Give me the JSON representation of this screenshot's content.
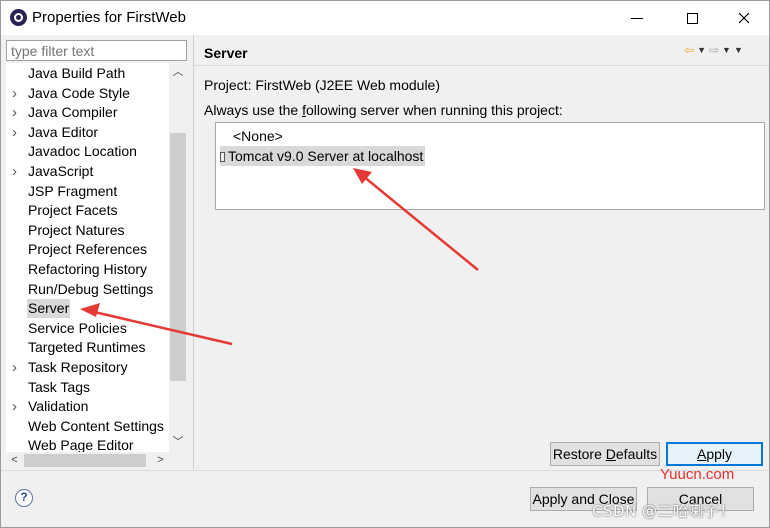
{
  "window": {
    "title": "Properties for FirstWeb",
    "controls": {
      "minimize": "minimize",
      "maximize": "maximize",
      "close": "close"
    }
  },
  "filter": {
    "placeholder": "type filter text"
  },
  "tree": {
    "items": [
      {
        "label": "Java Build Path",
        "expandable": false
      },
      {
        "label": "Java Code Style",
        "expandable": true
      },
      {
        "label": "Java Compiler",
        "expandable": true
      },
      {
        "label": "Java Editor",
        "expandable": true
      },
      {
        "label": "Javadoc Location",
        "expandable": false
      },
      {
        "label": "JavaScript",
        "expandable": true
      },
      {
        "label": "JSP Fragment",
        "expandable": false
      },
      {
        "label": "Project Facets",
        "expandable": false
      },
      {
        "label": "Project Natures",
        "expandable": false
      },
      {
        "label": "Project References",
        "expandable": false
      },
      {
        "label": "Refactoring History",
        "expandable": false
      },
      {
        "label": "Run/Debug Settings",
        "expandable": false
      },
      {
        "label": "Server",
        "expandable": false,
        "selected": true
      },
      {
        "label": "Service Policies",
        "expandable": false
      },
      {
        "label": "Targeted Runtimes",
        "expandable": false
      },
      {
        "label": "Task Repository",
        "expandable": true
      },
      {
        "label": "Task Tags",
        "expandable": false
      },
      {
        "label": "Validation",
        "expandable": true
      },
      {
        "label": "Web Content Settings",
        "expandable": false
      },
      {
        "label": "Web Page Editor",
        "expandable": false
      }
    ]
  },
  "page": {
    "title": "Server",
    "project_line": "Project: FirstWeb (J2EE Web module)",
    "always_prefix": "Always use the ",
    "always_underlined": "f",
    "always_suffix": "ollowing server when running this project:",
    "servers": [
      {
        "label": "<None>",
        "selected": false
      },
      {
        "label": "Tomcat v9.0 Server at localhost",
        "selected": true
      }
    ]
  },
  "buttons": {
    "restore_prefix": "Restore ",
    "restore_underlined": "D",
    "restore_suffix": "efaults",
    "apply_prefix": "",
    "apply_underlined": "A",
    "apply_suffix": "pply",
    "apply_close": "Apply and Close",
    "cancel": "Cancel"
  },
  "help": {
    "glyph": "?"
  },
  "watermarks": {
    "yuucn": "Yuucn.com",
    "csdn": "CSDN @二哈喇子！"
  },
  "colors": {
    "annotation_arrow": "#e53935",
    "selection": "#d9d9d9",
    "focus_border": "#0078d7"
  }
}
